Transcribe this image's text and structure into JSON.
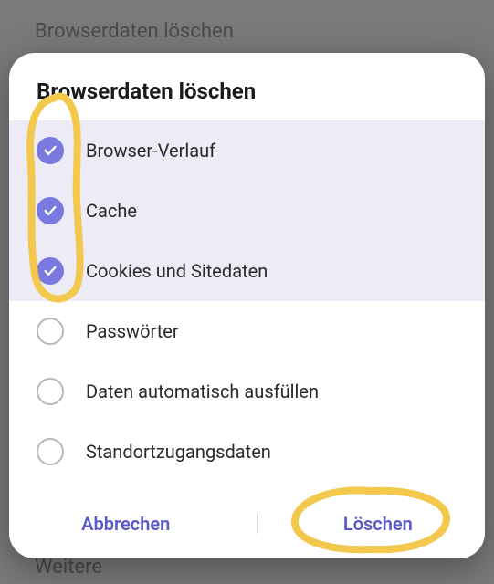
{
  "backdrop": {
    "title": "Browserdaten löschen",
    "footer": "Weitere"
  },
  "dialog": {
    "title": "Browserdaten löschen",
    "options": [
      {
        "label": "Browser-Verlauf",
        "checked": true
      },
      {
        "label": "Cache",
        "checked": true
      },
      {
        "label": "Cookies und Sitedaten",
        "checked": true
      },
      {
        "label": "Passwörter",
        "checked": false
      },
      {
        "label": "Daten automatisch ausfüllen",
        "checked": false
      },
      {
        "label": "Standortzugangsdaten",
        "checked": false
      }
    ],
    "actions": {
      "cancel": "Abbrechen",
      "confirm": "Löschen"
    }
  },
  "annotations": {
    "highlight_color": "#f2c94c"
  }
}
